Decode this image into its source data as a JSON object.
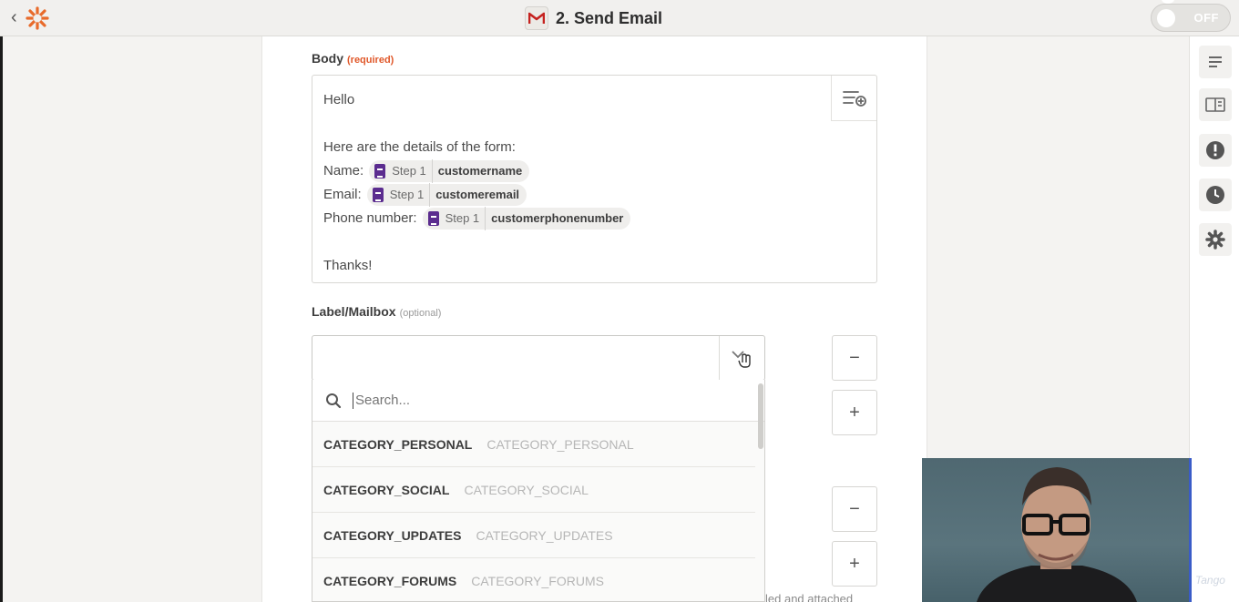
{
  "header": {
    "title": "2. Send Email",
    "toggle_label": "OFF"
  },
  "body_field": {
    "label": "Body",
    "required_tag": "(required)",
    "greeting": "Hello",
    "intro": "Here are the details of the form:",
    "rows": [
      {
        "label": "Name:",
        "step": "Step 1",
        "var": "customername"
      },
      {
        "label": "Email:",
        "step": "Step 1",
        "var": "customeremail"
      },
      {
        "label": "Phone number:",
        "step": "Step 1",
        "var": "customerphonenumber"
      }
    ],
    "closing": "Thanks!"
  },
  "label_field": {
    "label": "Label/Mailbox",
    "optional_tag": "(optional)",
    "search_placeholder": "Search...",
    "options": [
      {
        "main": "CATEGORY_PERSONAL",
        "sub": "CATEGORY_PERSONAL"
      },
      {
        "main": "CATEGORY_SOCIAL",
        "sub": "CATEGORY_SOCIAL"
      },
      {
        "main": "CATEGORY_UPDATES",
        "sub": "CATEGORY_UPDATES"
      },
      {
        "main": "CATEGORY_FORUMS",
        "sub": "CATEGORY_FORUMS"
      }
    ]
  },
  "buttons": {
    "minus": "−",
    "plus": "+"
  },
  "hint": "led and attached",
  "watermark": "Tango",
  "icons": {
    "back": "chevron-left-icon",
    "logo": "zapier-logo-icon",
    "gmail": "gmail-icon",
    "sidebar": [
      "details-icon",
      "help-book-icon",
      "alert-icon",
      "history-icon",
      "settings-icon"
    ]
  },
  "colors": {
    "accent_orange": "#e0582a",
    "gmail_red": "#c5221f",
    "step_purple": "#5b2c8f"
  }
}
